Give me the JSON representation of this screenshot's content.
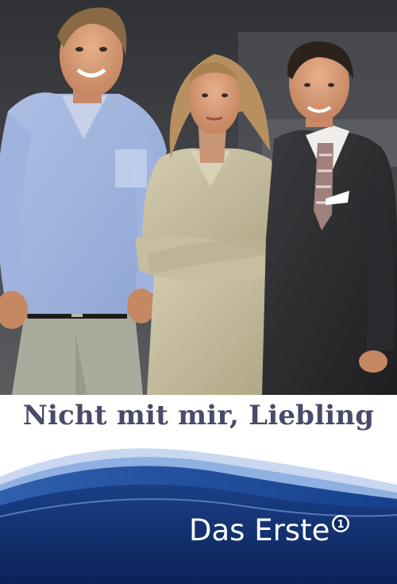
{
  "poster": {
    "title": "Nicht mit mir, Liebling",
    "broadcaster": "Das Erste",
    "broadcaster_logo_mark": "1"
  },
  "colors": {
    "title_text": "#4a4a6a",
    "wave_dark": "#0f2a64",
    "wave_mid": "#1c4a9a",
    "wave_light": "#8fb0e0",
    "backdrop": "#3a3c40"
  },
  "photo": {
    "subjects": [
      "man-left-blue-shirt",
      "woman-center-beige-dress",
      "man-right-dark-suit"
    ]
  }
}
